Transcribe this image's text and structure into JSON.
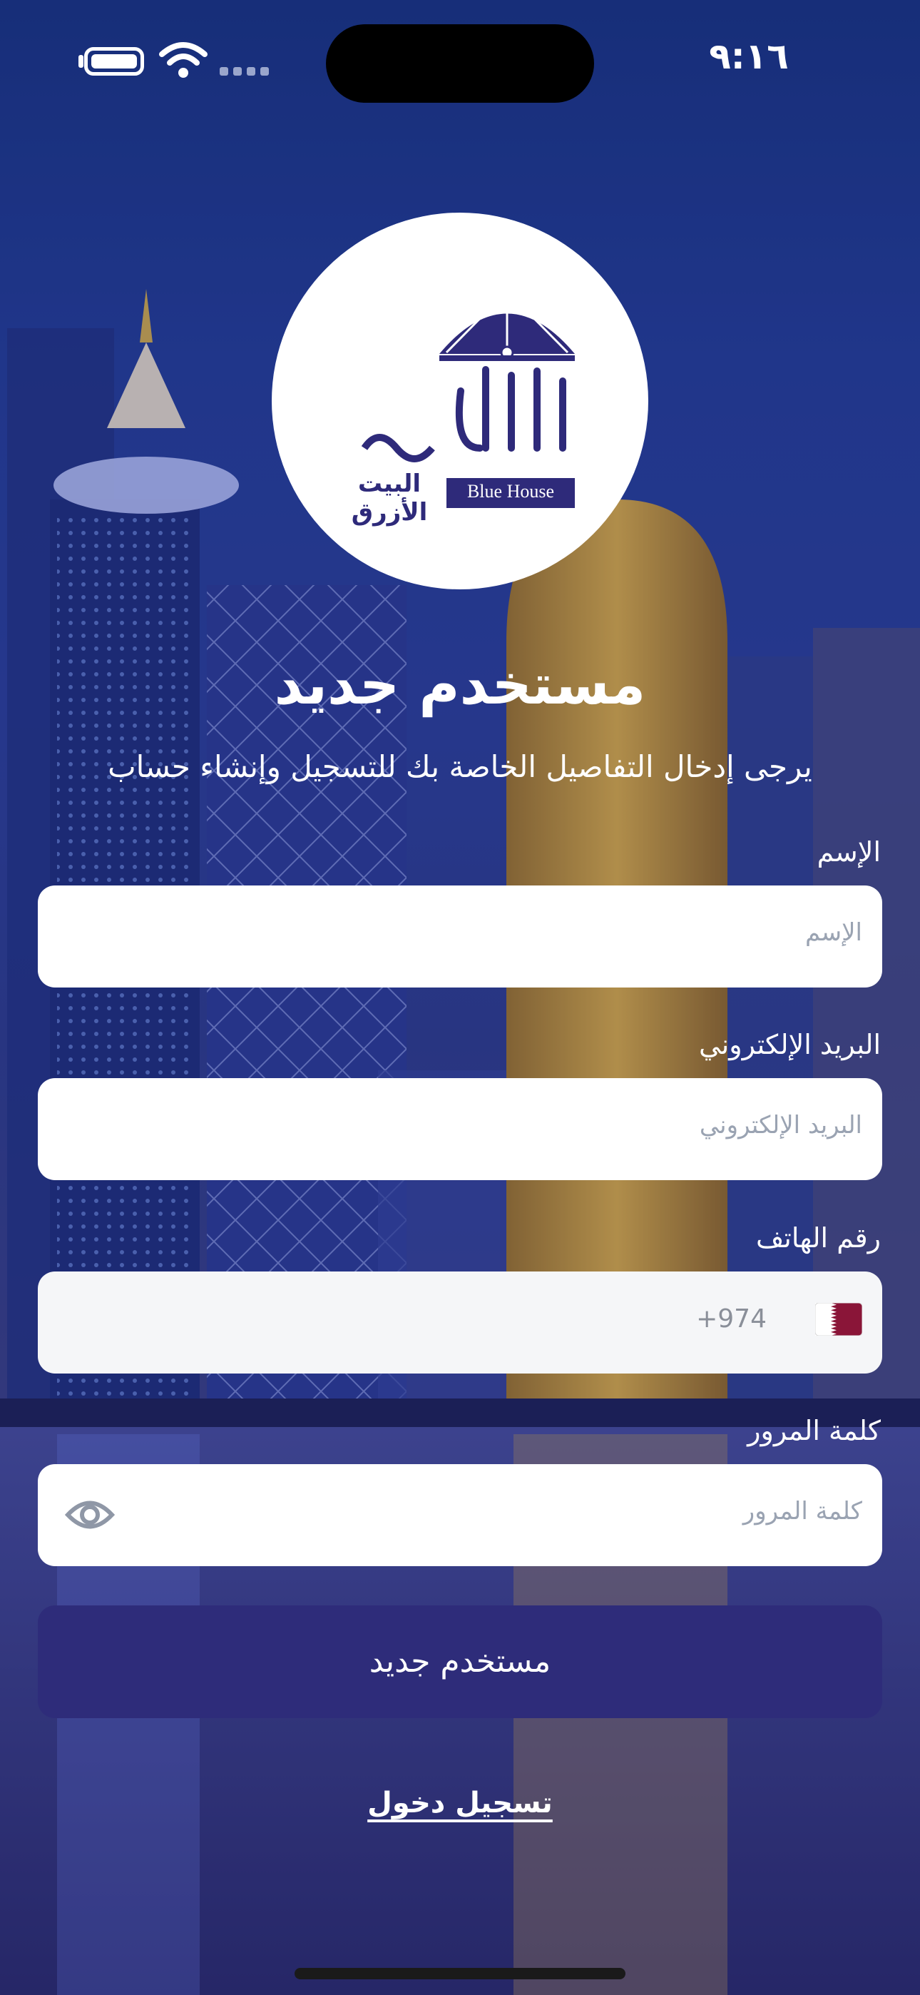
{
  "status_bar": {
    "time": "٩:١٦"
  },
  "logo": {
    "text_en": "Blue House",
    "text_ar": "البيت الأزرق"
  },
  "header": {
    "title": "مستخدم جديد",
    "subtitle": "يرجى إدخال التفاصيل الخاصة بك للتسجيل وإنشاء حساب"
  },
  "form": {
    "name": {
      "label": "الإسم",
      "placeholder": "الإسم"
    },
    "email": {
      "label": "البريد الإلكتروني",
      "placeholder": "البريد الإلكتروني"
    },
    "phone": {
      "label": "رقم الهاتف",
      "country_code": "+974",
      "flag": "qatar-flag"
    },
    "password": {
      "label": "كلمة المرور",
      "placeholder": "كلمة المرور"
    }
  },
  "actions": {
    "submit_label": "مستخدم جديد",
    "login_link": "تسجيل دخول"
  },
  "colors": {
    "primary": "#2e2c7a",
    "background": "#223c92",
    "flag_maroon": "#8a1538"
  }
}
